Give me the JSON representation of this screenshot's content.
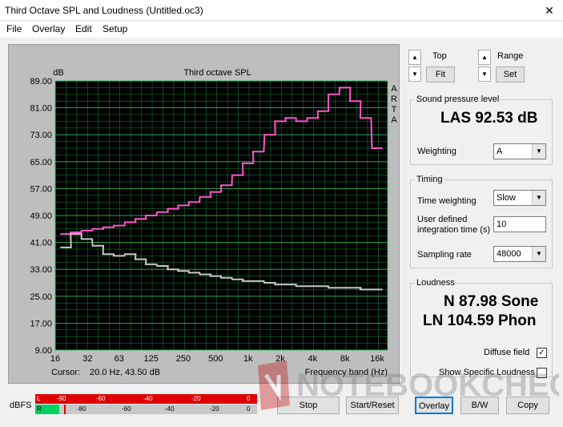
{
  "window": {
    "title": "Third Octave SPL and Loudness (Untitled.oc3)",
    "close_glyph": "✕"
  },
  "menu": [
    "File",
    "Overlay",
    "Edit",
    "Setup"
  ],
  "plot": {
    "title": "Third octave SPL",
    "y_unit": "dB",
    "right_label": [
      "A",
      "R",
      "T",
      "A"
    ],
    "y_ticks": [
      "89.00",
      "81.00",
      "73.00",
      "65.00",
      "57.00",
      "49.00",
      "41.00",
      "33.00",
      "25.00",
      "17.00",
      "9.00"
    ],
    "x_ticks": [
      "16",
      "32",
      "63",
      "125",
      "250",
      "500",
      "1k",
      "2k",
      "4k",
      "8k",
      "16k"
    ],
    "cursor_label": "Cursor:",
    "cursor_value": "20.0 Hz, 43.50 dB",
    "x_label": "Frequency band (Hz)"
  },
  "chart_data": {
    "type": "line",
    "title": "Third octave SPL",
    "ylabel": "dB",
    "xlabel": "Frequency band (Hz)",
    "x_scale": "log",
    "ylim": [
      9,
      89
    ],
    "xlim": [
      16,
      20000
    ],
    "grid": true,
    "x": [
      20,
      25,
      31.5,
      40,
      50,
      63,
      80,
      100,
      125,
      160,
      200,
      250,
      315,
      400,
      500,
      630,
      800,
      1000,
      1250,
      1600,
      2000,
      2500,
      3150,
      4000,
      5000,
      6300,
      8000,
      10000,
      12500,
      16000
    ],
    "series": [
      {
        "color": "#ff55cc",
        "values": [
          43.5,
          44,
          44.5,
          45,
          45.5,
          46,
          47,
          48,
          49,
          50,
          51,
          52,
          53,
          54.5,
          56,
          58,
          61,
          64.5,
          68,
          73,
          77,
          78,
          77,
          78,
          80,
          85,
          87,
          83,
          78,
          69
        ]
      },
      {
        "color": "#c8c8c8",
        "values": [
          39.5,
          43.5,
          42,
          40,
          37.5,
          37,
          37.5,
          36,
          34.5,
          34,
          33,
          32.5,
          32,
          31.5,
          31,
          30.5,
          30,
          29.5,
          29.5,
          29,
          28.5,
          28.5,
          28,
          28,
          28,
          27.5,
          27.5,
          27.5,
          27,
          27
        ]
      }
    ]
  },
  "top_controls": {
    "top_label": "Top",
    "fit_label": "Fit",
    "range_label": "Range",
    "set_label": "Set",
    "up_glyph": "▲",
    "down_glyph": "▼"
  },
  "spl": {
    "group_title": "Sound pressure level",
    "value": "LAS 92.53 dB",
    "weighting_label": "Weighting",
    "weighting_value": "A"
  },
  "timing": {
    "group_title": "Timing",
    "time_weighting_label": "Time weighting",
    "time_weighting_value": "Slow",
    "integration_label_1": "User defined",
    "integration_label_2": "integration time (s)",
    "integration_value": "10",
    "sampling_label": "Sampling rate",
    "sampling_value": "48000"
  },
  "loudness": {
    "group_title": "Loudness",
    "sone": "N 87.98 Sone",
    "phon": "LN 104.59 Phon",
    "diffuse_label": "Diffuse field",
    "specific_label": "Show Specific Loudness"
  },
  "meters": {
    "dbfs_label": "dBFS",
    "left_label": "L",
    "right_label": "R",
    "ticks": [
      "-90",
      "-80",
      "-60",
      "-40",
      "-20",
      "0"
    ],
    "left_level": 1.0,
    "right_level": 0.11
  },
  "buttons": {
    "stop": "Stop",
    "start_reset": "Start/Reset",
    "overlay": "Overlay",
    "bw": "B/W",
    "copy": "Copy"
  },
  "watermark": "NOTEBOOKCHECK"
}
